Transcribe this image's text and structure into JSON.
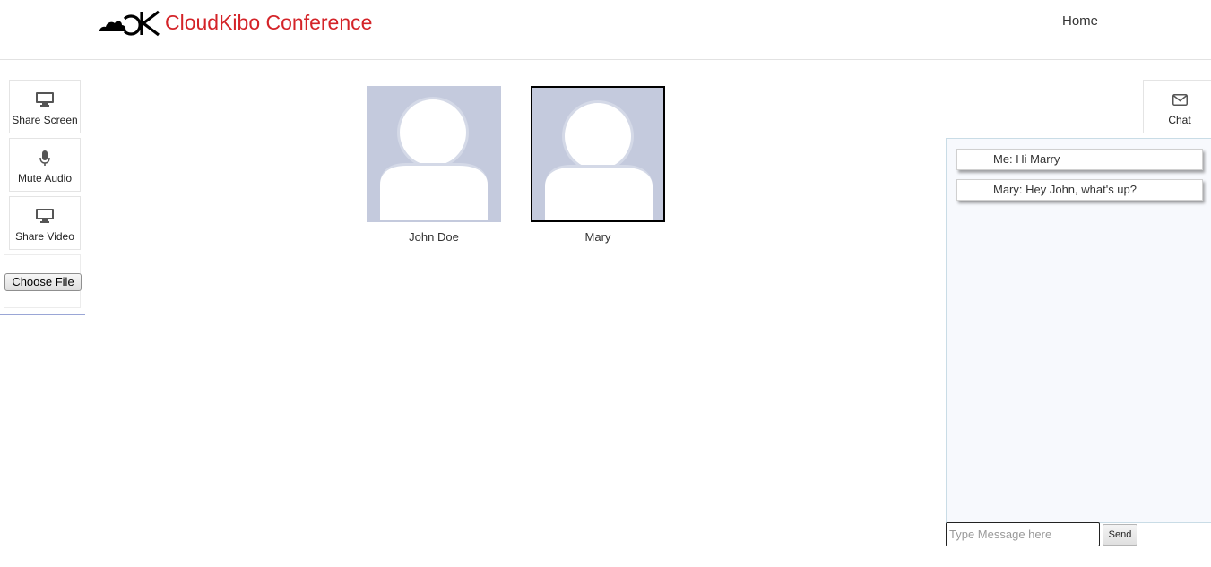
{
  "header": {
    "brand_name": "CloudKibo Conference",
    "brand_color": "#d42328",
    "nav": {
      "home": "Home"
    }
  },
  "toolbar": {
    "share_screen": {
      "label": "Share Screen",
      "icon": "monitor-icon"
    },
    "mute_audio": {
      "label": "Mute Audio",
      "icon": "microphone-icon"
    },
    "share_video": {
      "label": "Share Video",
      "icon": "monitor-icon"
    },
    "choose_file": {
      "label": "Choose File"
    }
  },
  "participants": [
    {
      "name": "John Doe",
      "active": false
    },
    {
      "name": "Mary",
      "active": true
    }
  ],
  "chat": {
    "toggle_label": "Chat",
    "toggle_icon": "envelope-icon",
    "messages": [
      {
        "text": "Me: Hi Marry"
      },
      {
        "text": "Mary: Hey John, what's up?"
      }
    ],
    "input_placeholder": "Type Message here",
    "input_value": "",
    "send_label": "Send"
  }
}
